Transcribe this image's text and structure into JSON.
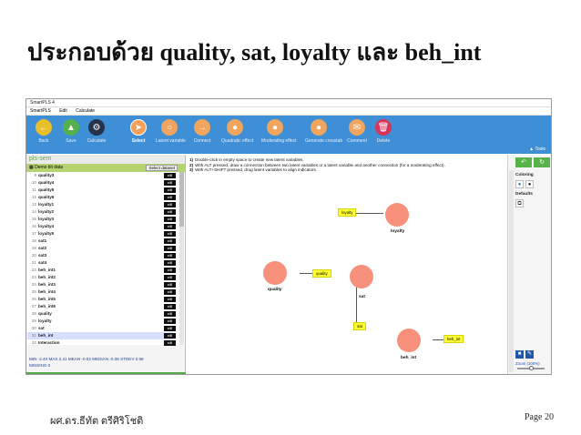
{
  "slide": {
    "title": "ประกอบด้วย quality, sat, loyalty และ beh_int",
    "author": "ผศ.ดร.ธีทัต ตรีศิริโชติ",
    "page": "Page 20"
  },
  "app": {
    "window_title": "SmartPLS 4",
    "menu": [
      "SmartPLS",
      "Edit",
      "Calculate"
    ],
    "toolbar": [
      {
        "label": "Back",
        "icon": "arrow-left-icon",
        "color": "#e6c12a"
      },
      {
        "label": "Save",
        "icon": "cloud-upload-icon",
        "color": "#54b04a"
      },
      {
        "label": "Calculate",
        "icon": "gear-icon",
        "color": "#26324a"
      },
      {
        "label": "Select",
        "icon": "cursor-icon",
        "color": "#f5a05a"
      },
      {
        "label": "Latent variable",
        "icon": "circle-icon",
        "color": "#f0a45d"
      },
      {
        "label": "Connect",
        "icon": "arrow-right-icon",
        "color": "#f0a45d"
      },
      {
        "label": "Quadratic effect",
        "icon": "person-icon",
        "color": "#f0a45d"
      },
      {
        "label": "Moderating effect",
        "icon": "person-icon",
        "color": "#f0a45d"
      },
      {
        "label": "Generate crosstab",
        "icon": "group-icon",
        "color": "#f0a45d"
      },
      {
        "label": "Comment",
        "icon": "comment-icon",
        "color": "#f0a45d"
      },
      {
        "label": "Delete",
        "icon": "trash-icon",
        "color": "#d8335a"
      }
    ],
    "tools_label": "Tools",
    "left_panel": {
      "header": "pls-sem",
      "data_file": "Demo tiit data",
      "select_button": "Select dataset",
      "indicators": [
        {
          "num": "9",
          "name": "quality3",
          "tag": "still"
        },
        {
          "num": "10",
          "name": "quality4",
          "tag": "still"
        },
        {
          "num": "11",
          "name": "quality5",
          "tag": "still"
        },
        {
          "num": "12",
          "name": "quality6",
          "tag": "still"
        },
        {
          "num": "13",
          "name": "loyalty1",
          "tag": "still"
        },
        {
          "num": "14",
          "name": "loyalty2",
          "tag": "still"
        },
        {
          "num": "15",
          "name": "loyalty3",
          "tag": "still"
        },
        {
          "num": "16",
          "name": "loyalty4",
          "tag": "still"
        },
        {
          "num": "17",
          "name": "loyalty5",
          "tag": "still"
        },
        {
          "num": "18",
          "name": "sat1",
          "tag": "still"
        },
        {
          "num": "19",
          "name": "sat2",
          "tag": "still"
        },
        {
          "num": "20",
          "name": "sat3",
          "tag": "still"
        },
        {
          "num": "21",
          "name": "sat4",
          "tag": "still"
        },
        {
          "num": "22",
          "name": "beh_int1",
          "tag": "still"
        },
        {
          "num": "23",
          "name": "beh_int2",
          "tag": "still"
        },
        {
          "num": "24",
          "name": "beh_int3",
          "tag": "still"
        },
        {
          "num": "25",
          "name": "beh_int4",
          "tag": "still"
        },
        {
          "num": "26",
          "name": "beh_int5",
          "tag": "still"
        },
        {
          "num": "27",
          "name": "beh_int6",
          "tag": "still"
        },
        {
          "num": "28",
          "name": "quality",
          "tag": "still"
        },
        {
          "num": "29",
          "name": "loyalty",
          "tag": "still"
        },
        {
          "num": "30",
          "name": "sat",
          "tag": "still"
        },
        {
          "num": "31",
          "name": "beh_int",
          "tag": "still"
        },
        {
          "num": "32",
          "name": "Interaction",
          "tag": "still"
        }
      ],
      "stats_line1": "MIN -2.40  MAX 2.41  MEAN -0.02  MEDIAN -0.08  STDEV 0.98",
      "stats_line2": "MISSING 0"
    },
    "canvas": {
      "instructions": [
        {
          "num": "1)",
          "text": "Double-click in empty space to create new latent variables."
        },
        {
          "num": "2)",
          "text": "With ALT pressed, draw a connection between two latent variables or a latent variable and another connection (for a moderating effect)."
        },
        {
          "num": "3)",
          "text": "With ALT+SHIFT pressed, drag latent variables to align indicators."
        }
      ],
      "nodes": {
        "loyalty": "loyalty",
        "quality": "quality",
        "sat": "sat",
        "beh_int": "beh_int"
      },
      "indicator_boxes": {
        "loyalty": "loyalty",
        "quality": "quality",
        "sat": "sat",
        "beh_int": "beh_int"
      }
    },
    "right_panel": {
      "coloring": "Coloring",
      "defaults": "Defaults",
      "zoom": "Zoom (100%)"
    },
    "colors": {
      "toolbar": "#3e8fd6",
      "node": "#f7917b",
      "indicator": "#ffff33",
      "data_row": "#b5d36f"
    }
  }
}
